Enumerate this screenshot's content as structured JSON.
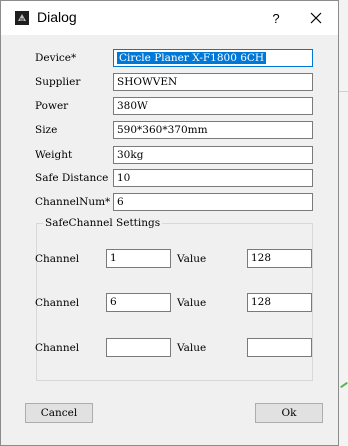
{
  "window": {
    "title": "Dialog",
    "help_label": "?"
  },
  "form": {
    "device": {
      "label": "Device*",
      "value": "Circle Planer X-F1800 6CH"
    },
    "supplier": {
      "label": "Supplier",
      "value": "SHOWVEN"
    },
    "power": {
      "label": "Power",
      "value": "380W"
    },
    "size": {
      "label": "Size",
      "value": "590*360*370mm"
    },
    "weight": {
      "label": "Weight",
      "value": "30kg"
    },
    "safe_distance": {
      "label": "Safe Distance",
      "value": "10"
    },
    "channel_num": {
      "label": "ChannelNum*",
      "value": "6"
    }
  },
  "safe_channel": {
    "title": "SafeChannel Settings",
    "rows": [
      {
        "channel_label": "Channel",
        "channel": "1",
        "value_label": "Value",
        "value": "128"
      },
      {
        "channel_label": "Channel",
        "channel": "6",
        "value_label": "Value",
        "value": "128"
      },
      {
        "channel_label": "Channel",
        "channel": "",
        "value_label": "Value",
        "value": ""
      }
    ]
  },
  "buttons": {
    "cancel": "Cancel",
    "ok": "Ok"
  },
  "colors": {
    "selection": "#0078d7",
    "dialog_bg": "#f0f0f0",
    "button_bg": "#e1e1e1"
  }
}
